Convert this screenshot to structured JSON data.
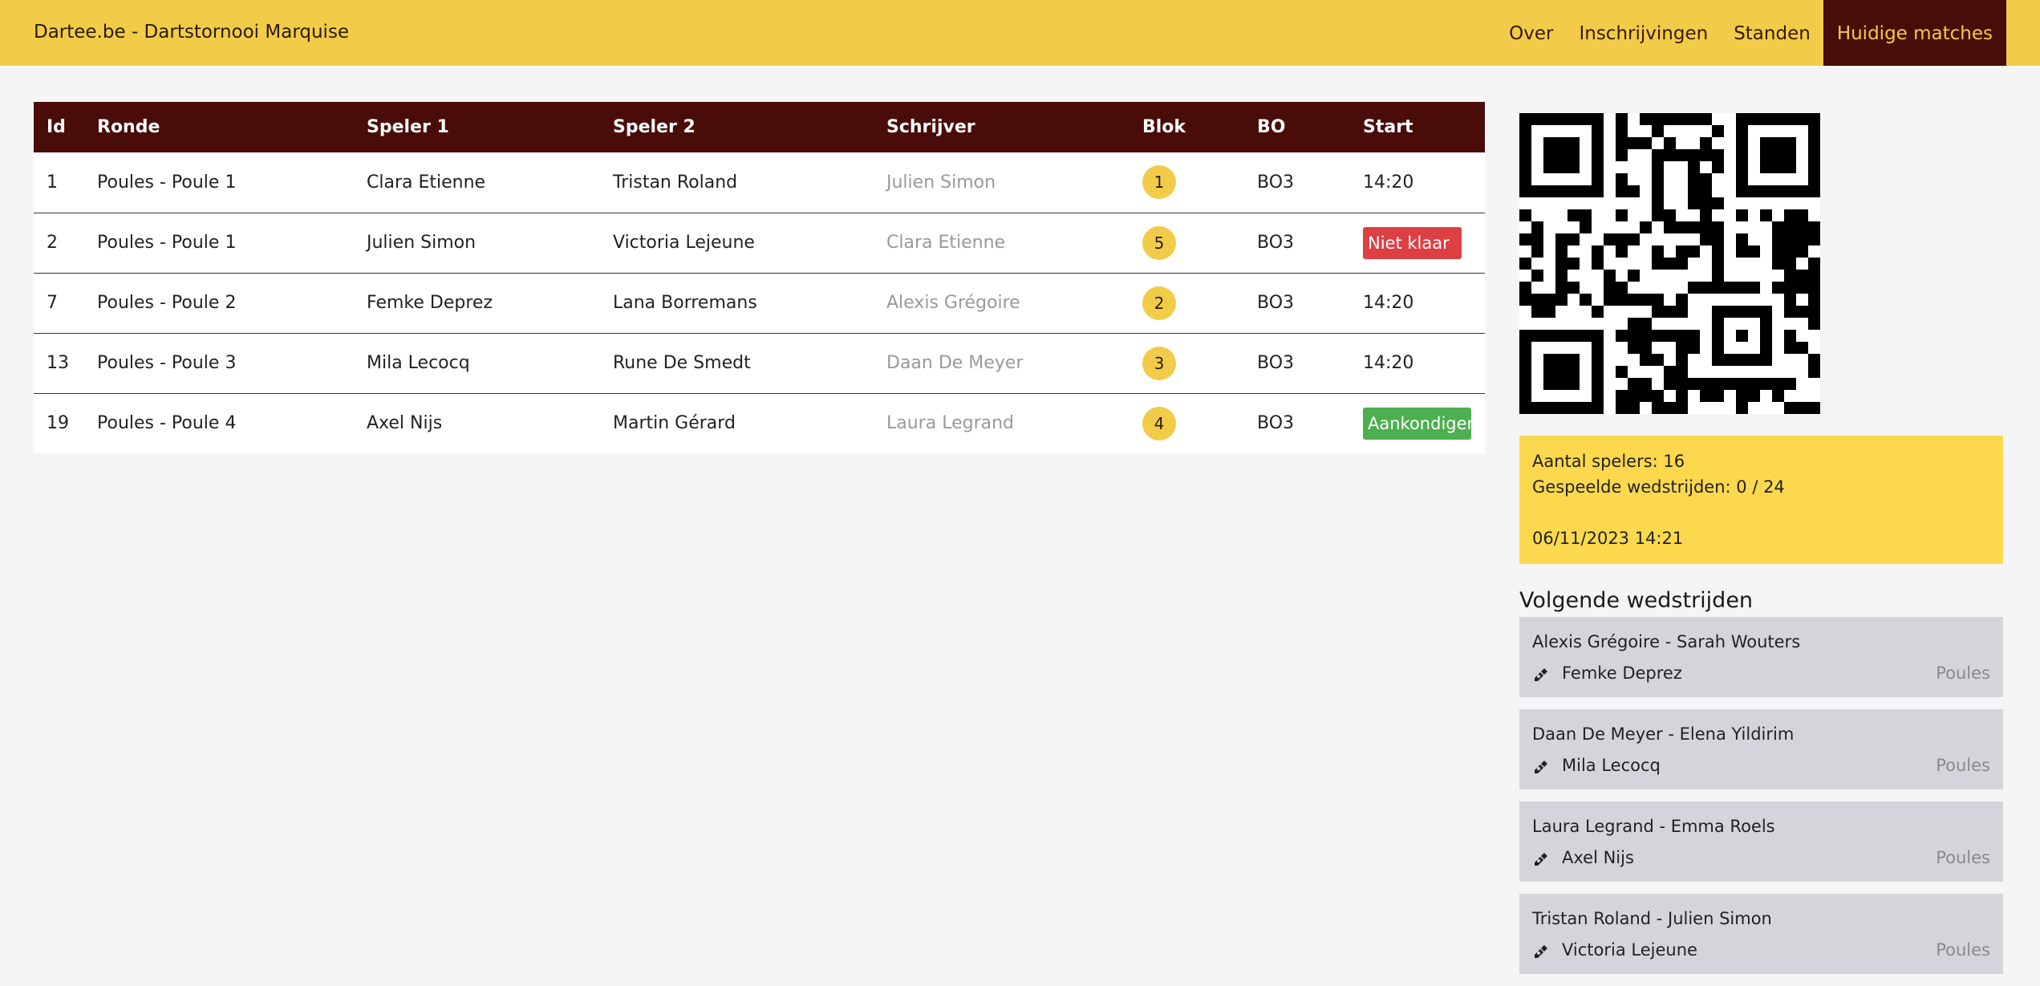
{
  "nav": {
    "brand": "Dartee.be - Dartstornooi Marquise",
    "links": [
      "Over",
      "Inschrijvingen",
      "Standen",
      "Huidige matches"
    ],
    "active": "Huidige matches"
  },
  "table": {
    "headers": [
      "Id",
      "Ronde",
      "Speler 1",
      "Speler 2",
      "Schrijver",
      "Blok",
      "BO",
      "Start"
    ],
    "rows": [
      {
        "id": "1",
        "ronde": "Poules - Poule 1",
        "speler1": "Clara Etienne",
        "speler2": "Tristan Roland",
        "schrijver": "Julien Simon",
        "blok": "1",
        "bo": "BO3",
        "start": "14:20",
        "start_type": "text"
      },
      {
        "id": "2",
        "ronde": "Poules - Poule 1",
        "speler1": "Julien Simon",
        "speler2": "Victoria Lejeune",
        "schrijver": "Clara Etienne",
        "blok": "5",
        "bo": "BO3",
        "start": "Niet klaar",
        "start_type": "red"
      },
      {
        "id": "7",
        "ronde": "Poules - Poule 2",
        "speler1": "Femke Deprez",
        "speler2": "Lana Borremans",
        "schrijver": "Alexis Grégoire",
        "blok": "2",
        "bo": "BO3",
        "start": "14:20",
        "start_type": "text"
      },
      {
        "id": "13",
        "ronde": "Poules - Poule 3",
        "speler1": "Mila Lecocq",
        "speler2": "Rune De Smedt",
        "schrijver": "Daan De Meyer",
        "blok": "3",
        "bo": "BO3",
        "start": "14:20",
        "start_type": "text"
      },
      {
        "id": "19",
        "ronde": "Poules - Poule 4",
        "speler1": "Axel Nijs",
        "speler2": "Martin Gérard",
        "schrijver": "Laura Legrand",
        "blok": "4",
        "bo": "BO3",
        "start": "Aankondigen",
        "start_type": "green"
      }
    ]
  },
  "stats": {
    "players": "Aantal spelers: 16",
    "played": "Gespeelde wedstrijden: 0 / 24",
    "datetime": "06/11/2023 14:21"
  },
  "next": {
    "title": "Volgende wedstrijden",
    "items": [
      {
        "players": "Alexis Grégoire - Sarah Wouters",
        "writer": "Femke Deprez",
        "round": "Poules"
      },
      {
        "players": "Daan De Meyer - Elena Yildirim",
        "writer": "Mila Lecocq",
        "round": "Poules"
      },
      {
        "players": "Laura Legrand - Emma Roels",
        "writer": "Axel Nijs",
        "round": "Poules"
      },
      {
        "players": "Tristan Roland - Julien Simon",
        "writer": "Victoria Lejeune",
        "round": "Poules"
      }
    ]
  },
  "colors": {
    "nav_bg": "#f2cc48",
    "accent_dark": "#4a0c08",
    "stats_bg": "#fcd84e",
    "card_bg": "#d4d5da",
    "danger": "#dc3f44",
    "success": "#4caf50"
  },
  "icons": {
    "writer": "pen-icon",
    "qr": "qr-code-image"
  }
}
